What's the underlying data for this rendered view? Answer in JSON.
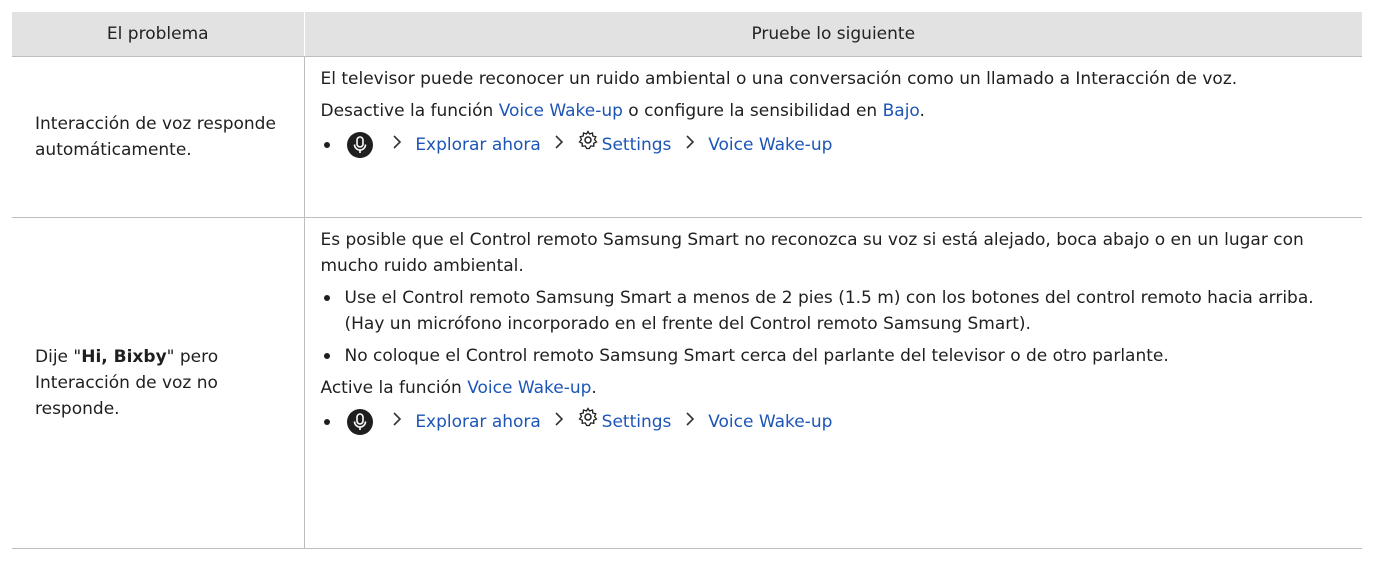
{
  "table": {
    "header": {
      "col1": "El problema",
      "col2": "Pruebe lo siguiente"
    },
    "rows": [
      {
        "problem": "Interacción de voz responde automáticamente.",
        "solution": {
          "p1": "El televisor puede reconocer un ruido ambiental o una conversación como un llamado a Interacción de voz.",
          "p2_pre": "Desactive la función ",
          "p2_link1": "Voice Wake-up",
          "p2_mid": " o configure la sensibilidad en ",
          "p2_link2": "Bajo",
          "p2_post": ".",
          "path": [
            "Explorar ahora",
            "Settings",
            "Voice Wake-up"
          ]
        }
      },
      {
        "problem_pre": "Dije \"",
        "problem_bold": "Hi, Bixby",
        "problem_post": "\" pero Interacción de voz no responde.",
        "solution": {
          "p1": "Es posible que el Control remoto Samsung Smart no reconozca su voz si está alejado, boca abajo o en un lugar con mucho ruido ambiental.",
          "bullets": [
            "Use el Control remoto Samsung Smart a menos de 2 pies (1.5 m) con los botones del control remoto hacia arriba. (Hay un micrófono incorporado en el frente del Control remoto Samsung Smart).",
            "No coloque el Control remoto Samsung Smart cerca del parlante del televisor o de otro parlante."
          ],
          "p2_pre": "Active la función ",
          "p2_link": "Voice Wake-up",
          "p2_post": ".",
          "path": [
            "Explorar ahora",
            "Settings",
            "Voice Wake-up"
          ]
        }
      }
    ]
  },
  "icons": {
    "mic": "microphone-icon",
    "chevron": "chevron-right-icon",
    "gear": "gear-icon"
  },
  "colors": {
    "link": "#1d55b6",
    "header_bg": "#e2e2e2",
    "border": "#bdbdbd"
  }
}
